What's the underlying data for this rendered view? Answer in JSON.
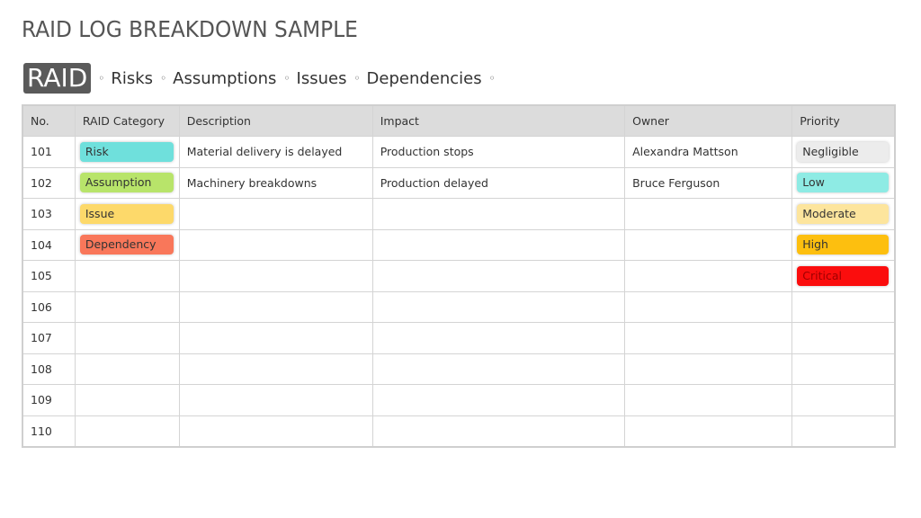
{
  "title": "RAID LOG BREAKDOWN SAMPLE",
  "nav": {
    "badge": "RAID",
    "separator": "◦",
    "items": [
      "Risks",
      "Assumptions",
      "Issues",
      "Dependencies"
    ]
  },
  "table": {
    "headers": [
      "No.",
      "RAID Category",
      "Description",
      "Impact",
      "Owner",
      "Priority"
    ],
    "rows": [
      {
        "no": "101",
        "category": "Risk",
        "category_color": "#6fe0dc",
        "category_text": "#333333",
        "description": "Material delivery is delayed",
        "impact": "Production stops",
        "owner": "Alexandra Mattson",
        "priority": "Negligible",
        "priority_color": "#ececec",
        "priority_text": "#333333"
      },
      {
        "no": "102",
        "category": "Assumption",
        "category_color": "#b8e46a",
        "category_text": "#333333",
        "description": "Machinery breakdowns",
        "impact": "Production delayed",
        "owner": "Bruce Ferguson",
        "priority": "Low",
        "priority_color": "#8eebe4",
        "priority_text": "#333333"
      },
      {
        "no": "103",
        "category": "Issue",
        "category_color": "#fdd96a",
        "category_text": "#333333",
        "description": "",
        "impact": "",
        "owner": "",
        "priority": "Moderate",
        "priority_color": "#fde59d",
        "priority_text": "#333333"
      },
      {
        "no": "104",
        "category": "Dependency",
        "category_color": "#f9775a",
        "category_text": "#333333",
        "description": "",
        "impact": "",
        "owner": "",
        "priority": "High",
        "priority_color": "#fdbf0f",
        "priority_text": "#333333"
      },
      {
        "no": "105",
        "category": "",
        "description": "",
        "impact": "",
        "owner": "",
        "priority": "Critical",
        "priority_color": "#fb0d0d",
        "priority_text": "#a00000"
      },
      {
        "no": "106",
        "category": "",
        "description": "",
        "impact": "",
        "owner": "",
        "priority": ""
      },
      {
        "no": "107",
        "category": "",
        "description": "",
        "impact": "",
        "owner": "",
        "priority": ""
      },
      {
        "no": "108",
        "category": "",
        "description": "",
        "impact": "",
        "owner": "",
        "priority": ""
      },
      {
        "no": "109",
        "category": "",
        "description": "",
        "impact": "",
        "owner": "",
        "priority": ""
      },
      {
        "no": "110",
        "category": "",
        "description": "",
        "impact": "",
        "owner": "",
        "priority": ""
      }
    ]
  }
}
